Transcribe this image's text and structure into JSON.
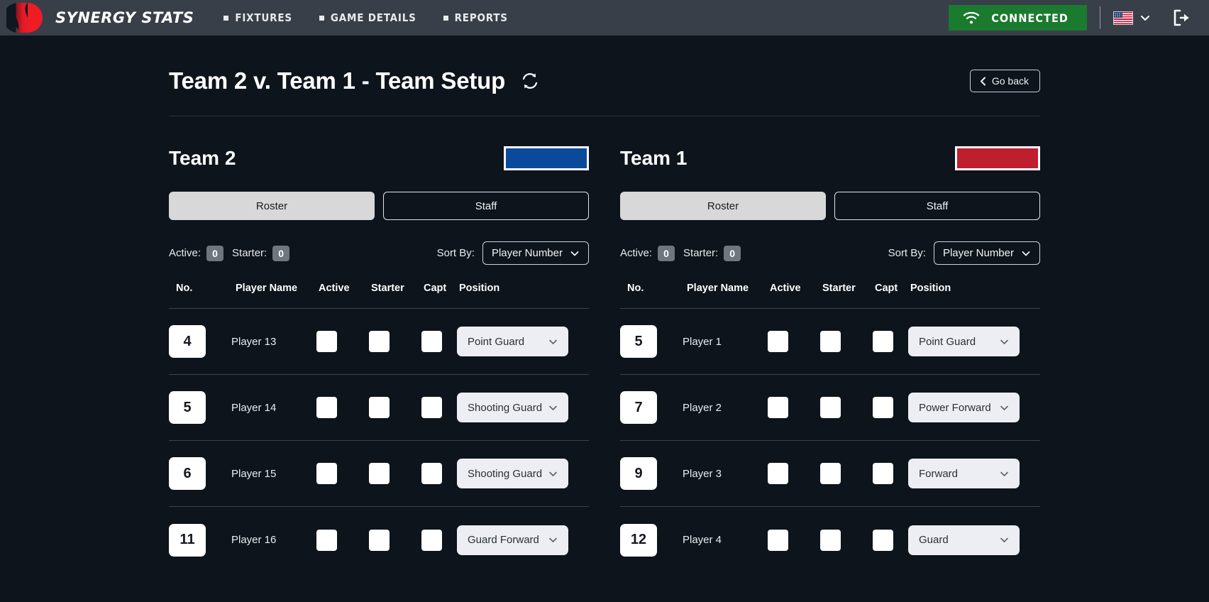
{
  "brand": {
    "name": "SYNERGY STATS",
    "logo_icon": "synergy-logo"
  },
  "nav": {
    "items": [
      {
        "label": "FIXTURES",
        "icon": "square-bullet-icon"
      },
      {
        "label": "GAME DETAILS",
        "icon": "square-bullet-icon"
      },
      {
        "label": "REPORTS",
        "icon": "square-bullet-icon"
      }
    ],
    "connection": {
      "label": "CONNECTED",
      "icon": "wifi-icon",
      "color": "#1a7a2e"
    },
    "language": {
      "icon": "us-flag-icon",
      "chevron": "chevron-down-icon"
    },
    "logout": {
      "icon": "logout-icon"
    },
    "bar_color": "#383f49"
  },
  "header": {
    "title": "Team 2 v. Team 1 - Team Setup",
    "refresh_icon": "refresh-icon",
    "go_back": {
      "label": "Go back",
      "icon": "chevron-left-icon"
    }
  },
  "columns": [
    "No.",
    "Player Name",
    "Active",
    "Starter",
    "Capt",
    "Position"
  ],
  "labels": {
    "active": "Active:",
    "starter": "Starter:",
    "sort_by": "Sort By:",
    "tab_roster": "Roster",
    "tab_staff": "Staff",
    "chevron_down_icon": "chevron-down-icon"
  },
  "teams": [
    {
      "name": "Team 2",
      "color": "#0b4a9b",
      "active_tab": "Roster",
      "active_count": "0",
      "starter_count": "0",
      "sort_value": "Player Number",
      "players": [
        {
          "no": "4",
          "name": "Player 13",
          "active": false,
          "starter": false,
          "capt": false,
          "position": "Point Guard"
        },
        {
          "no": "5",
          "name": "Player 14",
          "active": false,
          "starter": false,
          "capt": false,
          "position": "Shooting Guard"
        },
        {
          "no": "6",
          "name": "Player 15",
          "active": false,
          "starter": false,
          "capt": false,
          "position": "Shooting Guard"
        },
        {
          "no": "11",
          "name": "Player 16",
          "active": false,
          "starter": false,
          "capt": false,
          "position": "Guard Forward"
        }
      ]
    },
    {
      "name": "Team 1",
      "color": "#bf1e2e",
      "active_tab": "Roster",
      "active_count": "0",
      "starter_count": "0",
      "sort_value": "Player Number",
      "players": [
        {
          "no": "5",
          "name": "Player 1",
          "active": false,
          "starter": false,
          "capt": false,
          "position": "Point Guard"
        },
        {
          "no": "7",
          "name": "Player 2",
          "active": false,
          "starter": false,
          "capt": false,
          "position": "Power Forward"
        },
        {
          "no": "9",
          "name": "Player 3",
          "active": false,
          "starter": false,
          "capt": false,
          "position": "Forward"
        },
        {
          "no": "12",
          "name": "Player 4",
          "active": false,
          "starter": false,
          "capt": false,
          "position": "Guard"
        }
      ]
    }
  ]
}
